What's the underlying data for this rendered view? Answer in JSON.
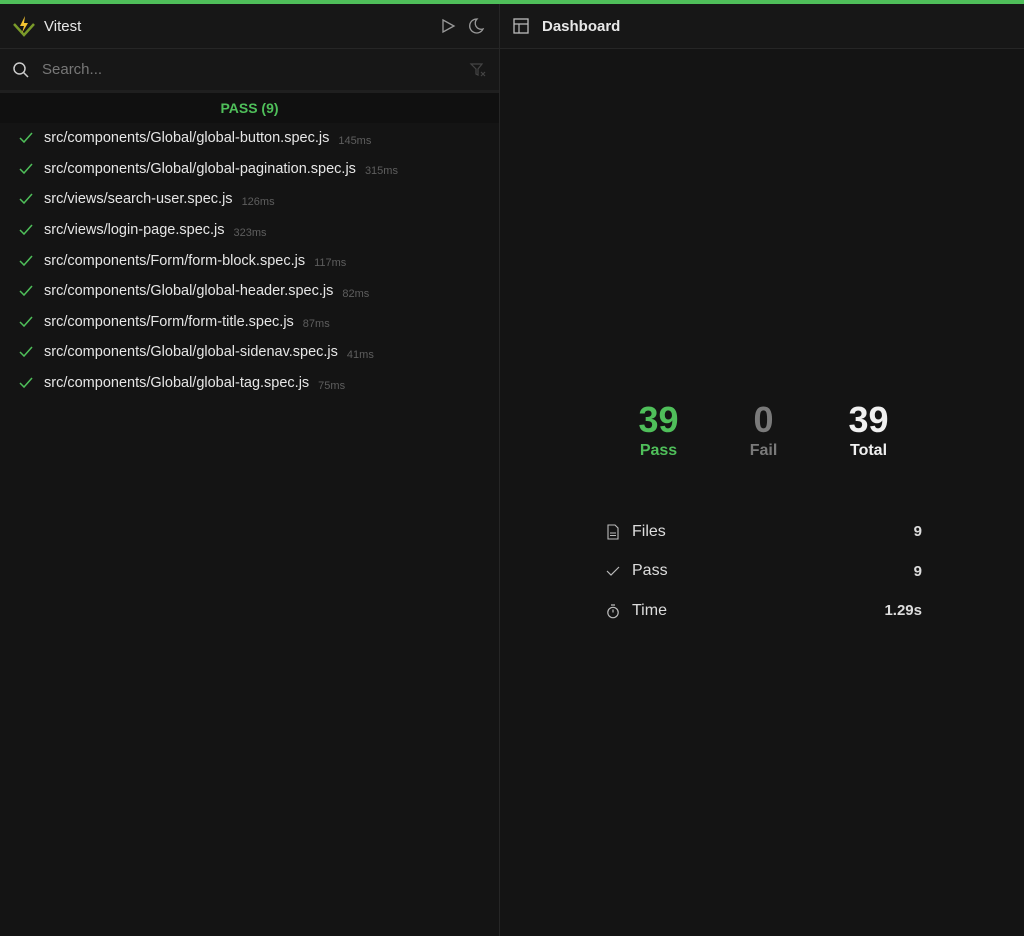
{
  "app": {
    "title": "Vitest",
    "accent": "#4fbf5a"
  },
  "search": {
    "placeholder": "Search..."
  },
  "group": {
    "label": "PASS (9)"
  },
  "files": [
    {
      "name": "src/components/Global/global-button.spec.js",
      "duration": "145ms"
    },
    {
      "name": "src/components/Global/global-pagination.spec.js",
      "duration": "315ms"
    },
    {
      "name": "src/views/search-user.spec.js",
      "duration": "126ms"
    },
    {
      "name": "src/views/login-page.spec.js",
      "duration": "323ms"
    },
    {
      "name": "src/components/Form/form-block.spec.js",
      "duration": "117ms"
    },
    {
      "name": "src/components/Global/global-header.spec.js",
      "duration": "82ms"
    },
    {
      "name": "src/components/Form/form-title.spec.js",
      "duration": "87ms"
    },
    {
      "name": "src/components/Global/global-sidenav.spec.js",
      "duration": "41ms"
    },
    {
      "name": "src/components/Global/global-tag.spec.js",
      "duration": "75ms"
    }
  ],
  "dashboard": {
    "title": "Dashboard",
    "summary": [
      {
        "value": "39",
        "label": "Pass",
        "color": "#4fbf5a"
      },
      {
        "value": "0",
        "label": "Fail",
        "color": "#7a7a7a"
      },
      {
        "value": "39",
        "label": "Total",
        "color": "#f0f0f0"
      }
    ],
    "details": [
      {
        "label": "Files",
        "value": "9",
        "icon": "file-icon"
      },
      {
        "label": "Pass",
        "value": "9",
        "icon": "check-icon"
      },
      {
        "label": "Time",
        "value": "1.29s",
        "icon": "timer-icon"
      }
    ]
  }
}
